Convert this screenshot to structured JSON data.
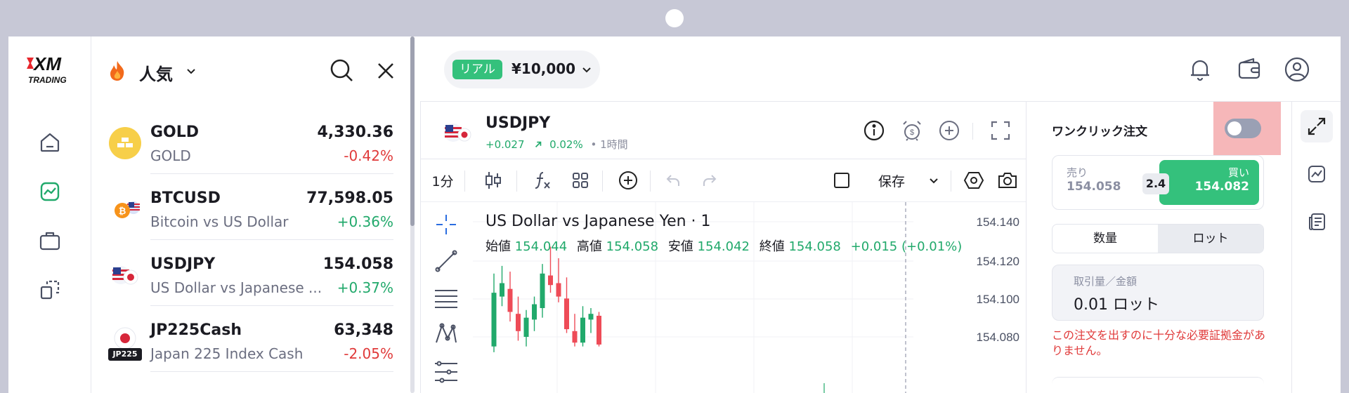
{
  "brand": {
    "line1": "XM",
    "line2": "TRADING"
  },
  "nav": {
    "items": [
      "home",
      "chart",
      "portfolio",
      "copy"
    ],
    "active": "chart"
  },
  "market": {
    "category": "人気",
    "rows": [
      {
        "symbol": "GOLD",
        "desc": "GOLD",
        "price": "4,330.36",
        "change": "-0.42%",
        "dir": "down",
        "icon": "gold-bars-icon"
      },
      {
        "symbol": "BTCUSD",
        "desc": "Bitcoin vs US Dollar",
        "price": "77,598.05",
        "change": "+0.36%",
        "dir": "up",
        "icon": "bitcoin-usd-icon"
      },
      {
        "symbol": "USDJPY",
        "desc": "US Dollar vs Japanese ...",
        "price": "154.058",
        "change": "+0.37%",
        "dir": "up",
        "icon": "usd-jpy-flags-icon"
      },
      {
        "symbol": "JP225Cash",
        "desc": "Japan 225 Index Cash",
        "price": "63,348",
        "change": "-2.05%",
        "dir": "down",
        "icon": "japan-flag-icon",
        "badge": "JP225"
      }
    ]
  },
  "account": {
    "type": "リアル",
    "balance": "¥10,000"
  },
  "instrument": {
    "symbol": "USDJPY",
    "change_abs": "+0.027",
    "change_pct": "0.02%",
    "timeframe": "• 1時間"
  },
  "toolbar": {
    "interval": "1分",
    "save": "保存"
  },
  "chart_data": {
    "type": "candlestick",
    "title": "US Dollar vs Japanese Yen · 1",
    "ohlc": {
      "open_label": "始値",
      "open": "154.044",
      "high_label": "高値",
      "high": "154.058",
      "low_label": "安値",
      "low": "154.042",
      "close_label": "終値",
      "close": "154.058",
      "change": "+0.015 (+0.01%)"
    },
    "y_ticks": [
      "154.140",
      "154.120",
      "154.100",
      "154.080"
    ],
    "ylim": [
      154.075,
      154.145
    ],
    "candles": [
      {
        "o": 154.075,
        "h": 154.113,
        "l": 154.072,
        "c": 154.103,
        "dir": "up"
      },
      {
        "o": 154.101,
        "h": 154.117,
        "l": 154.096,
        "c": 154.108,
        "dir": "up"
      },
      {
        "o": 154.105,
        "h": 154.114,
        "l": 154.088,
        "c": 154.093,
        "dir": "down"
      },
      {
        "o": 154.092,
        "h": 154.101,
        "l": 154.078,
        "c": 154.083,
        "dir": "down"
      },
      {
        "o": 154.08,
        "h": 154.094,
        "l": 154.075,
        "c": 154.09,
        "dir": "up"
      },
      {
        "o": 154.089,
        "h": 154.101,
        "l": 154.083,
        "c": 154.097,
        "dir": "up"
      },
      {
        "o": 154.095,
        "h": 154.118,
        "l": 154.09,
        "c": 154.113,
        "dir": "up"
      },
      {
        "o": 154.112,
        "h": 154.127,
        "l": 154.103,
        "c": 154.107,
        "dir": "down"
      },
      {
        "o": 154.108,
        "h": 154.121,
        "l": 154.098,
        "c": 154.101,
        "dir": "down"
      },
      {
        "o": 154.1,
        "h": 154.111,
        "l": 154.082,
        "c": 154.084,
        "dir": "down"
      },
      {
        "o": 154.083,
        "h": 154.092,
        "l": 154.075,
        "c": 154.077,
        "dir": "down"
      },
      {
        "o": 154.077,
        "h": 154.096,
        "l": 154.075,
        "c": 154.09,
        "dir": "up"
      },
      {
        "o": 154.089,
        "h": 154.095,
        "l": 154.082,
        "c": 154.092,
        "dir": "up"
      },
      {
        "o": 154.091,
        "h": 154.093,
        "l": 154.075,
        "c": 154.076,
        "dir": "down"
      }
    ],
    "colors": {
      "up": "#21a96b",
      "down": "#ee4b57"
    }
  },
  "order": {
    "one_click_label": "ワンクリック注文",
    "sell_label": "売り",
    "sell_price": "154.058",
    "buy_label": "買い",
    "buy_price": "154.082",
    "spread": "2.4",
    "tab_qty": "数量",
    "tab_lot": "ロット",
    "amount_label": "取引量／金額",
    "amount_value": "0.01 ロット",
    "warning": "この注文を出すのに十分な必要証拠金がありません。"
  },
  "colors": {
    "accent": "#34c17c",
    "down": "#e03a3a",
    "up": "#21a96b"
  }
}
